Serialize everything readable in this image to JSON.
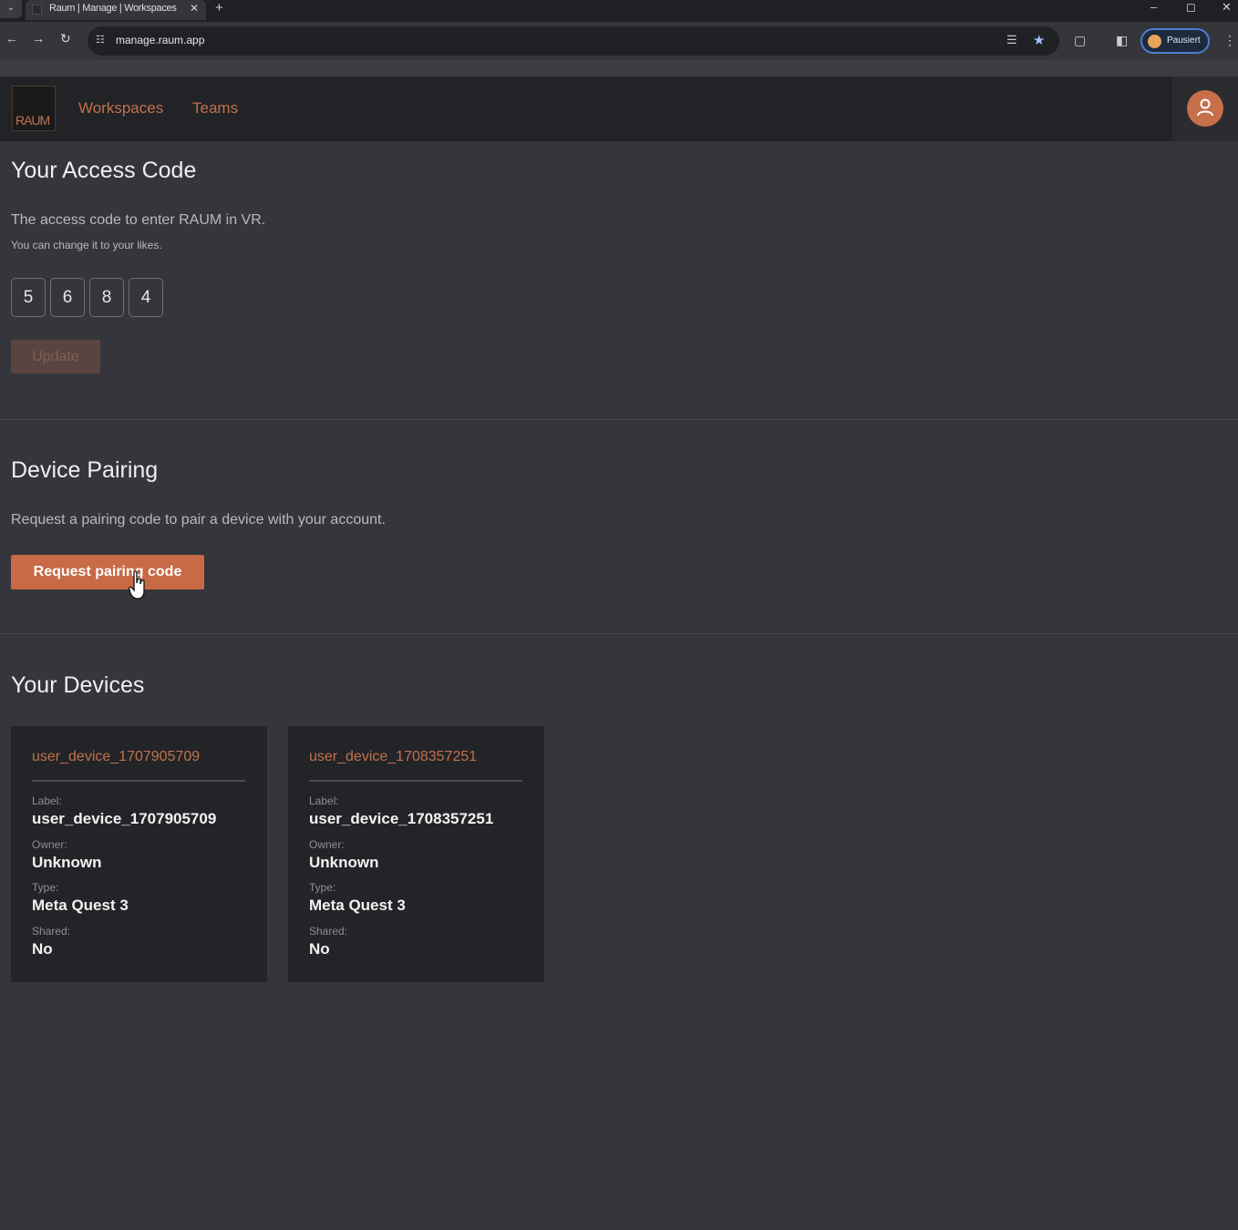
{
  "browser": {
    "tab_title": "Raum | Manage | Workspaces",
    "url": "manage.raum.app",
    "profile_label": "Pausiert",
    "accent": "#4b7fcf"
  },
  "header": {
    "logo_text": "RAUM",
    "nav": [
      "Workspaces",
      "Teams"
    ],
    "accent": "#c2714c"
  },
  "access_code": {
    "title": "Your Access Code",
    "description": "The access code to enter RAUM in VR.",
    "hint": "You can change it to your likes.",
    "digits": [
      "5",
      "6",
      "8",
      "4"
    ],
    "update_label": "Update"
  },
  "pairing": {
    "title": "Device Pairing",
    "description": "Request a pairing code to pair a device with your account.",
    "button_label": "Request pairing code"
  },
  "devices": {
    "title": "Your Devices",
    "labels": {
      "label": "Label:",
      "owner": "Owner:",
      "type": "Type:",
      "shared": "Shared:"
    },
    "items": [
      {
        "name": "user_device_1707905709",
        "label": "user_device_1707905709",
        "owner": "Unknown",
        "type": "Meta Quest 3",
        "shared": "No"
      },
      {
        "name": "user_device_1708357251",
        "label": "user_device_1708357251",
        "owner": "Unknown",
        "type": "Meta Quest 3",
        "shared": "No"
      }
    ]
  }
}
